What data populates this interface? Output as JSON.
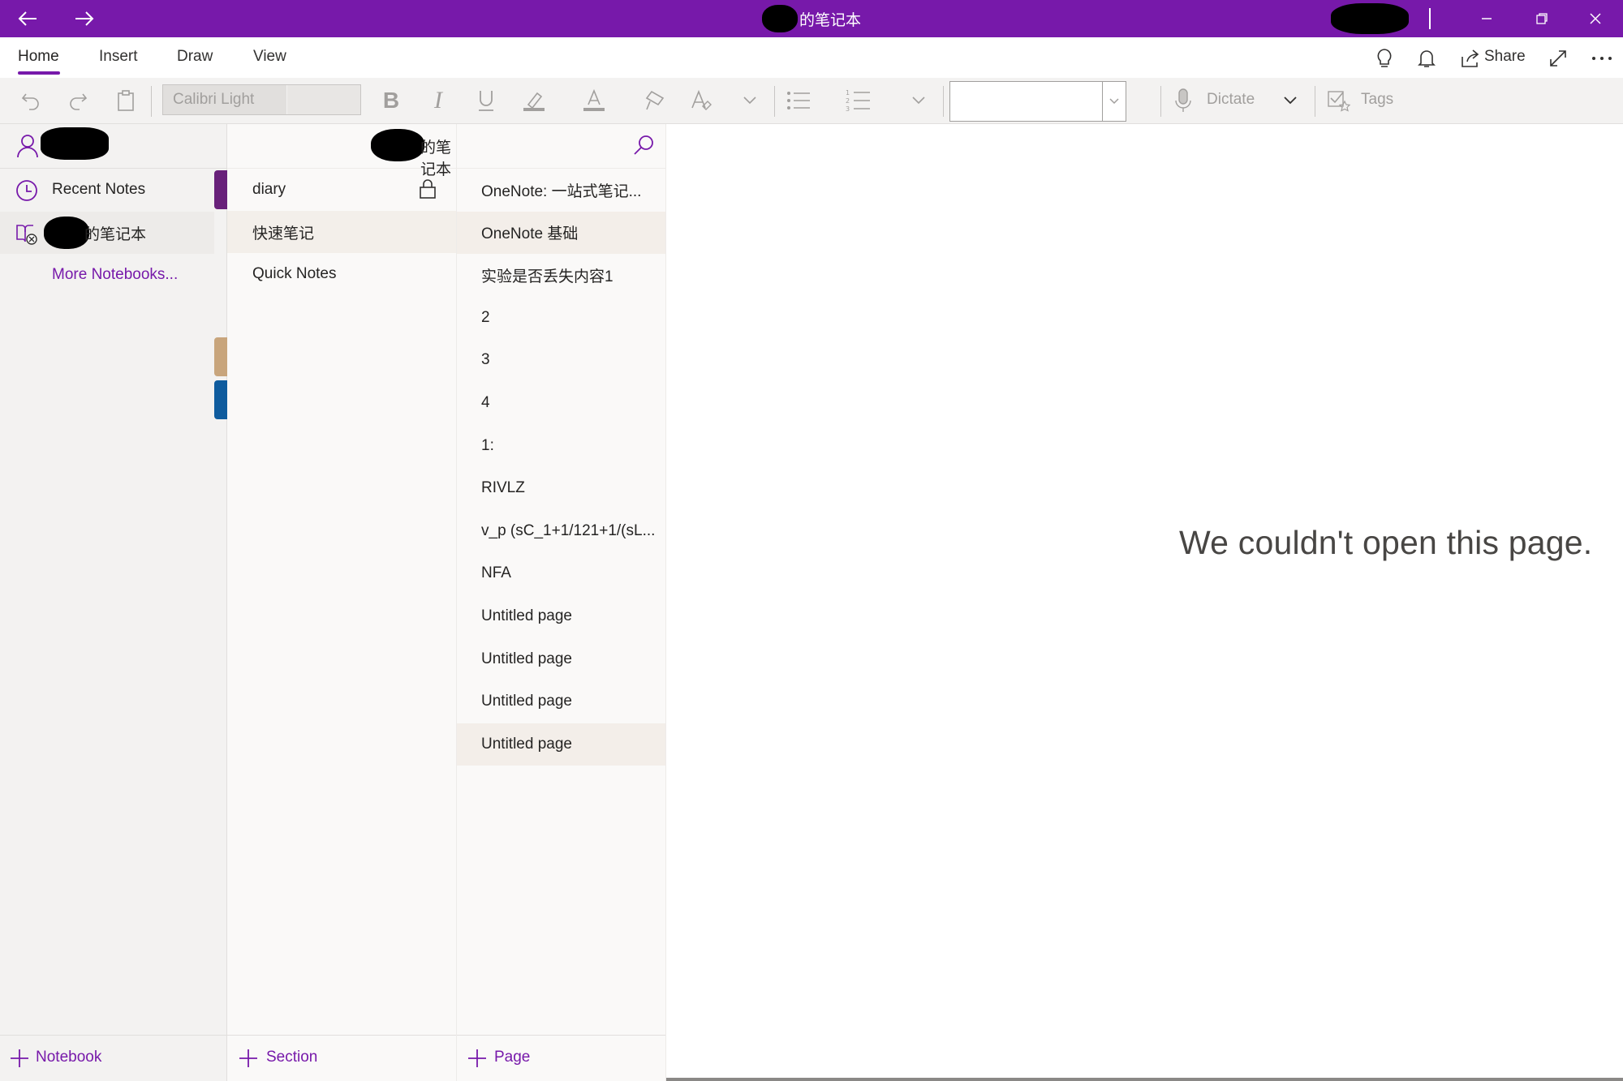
{
  "titlebar": {
    "title_suffix": "的笔记本",
    "colors": {
      "brand": "#7719aa"
    },
    "back_icon": "arrow-left-icon",
    "forward_icon": "arrow-right-icon"
  },
  "tabs": [
    {
      "label": "Home",
      "active": true
    },
    {
      "label": "Insert",
      "active": false
    },
    {
      "label": "Draw",
      "active": false
    },
    {
      "label": "View",
      "active": false
    }
  ],
  "tabs_right": {
    "share_label": "Share"
  },
  "ribbon": {
    "font_name": "Calibri Light",
    "dictate_label": "Dictate",
    "tags_label": "Tags"
  },
  "notebooks_pane": {
    "header_user_masked": true,
    "recent_notes_label": "Recent Notes",
    "notebook_name_suffix": "的笔记本",
    "more_notebooks_label": "More Notebooks...",
    "footer_label": "Notebook",
    "section_colors": [
      "#68217a",
      "#c8a57c",
      "#0f5c9e"
    ]
  },
  "sections_pane": {
    "header_suffix": "的笔记本",
    "sections": [
      {
        "label": "diary",
        "locked": true,
        "selected": false
      },
      {
        "label": "快速笔记",
        "locked": false,
        "selected": true
      },
      {
        "label": "Quick Notes",
        "locked": false,
        "selected": false
      }
    ],
    "footer_label": "Section"
  },
  "pages_pane": {
    "pages": [
      {
        "label": "OneNote: 一站式笔记...",
        "selected": false
      },
      {
        "label": "OneNote 基础",
        "selected": true
      },
      {
        "label": "实验是否丢失内容1",
        "selected": false
      },
      {
        "label": "2",
        "selected": false
      },
      {
        "label": "3",
        "selected": false
      },
      {
        "label": "4",
        "selected": false
      },
      {
        "label": "1:",
        "selected": false
      },
      {
        "label": "RIVLZ",
        "selected": false
      },
      {
        "label": "v_p (sC_1+1/121+1/(sL...",
        "selected": false
      },
      {
        "label": "NFA",
        "selected": false
      },
      {
        "label": "Untitled page",
        "selected": false
      },
      {
        "label": "Untitled page",
        "selected": false
      },
      {
        "label": "Untitled page",
        "selected": false
      },
      {
        "label": "Untitled page",
        "selected": true
      }
    ],
    "footer_label": "Page"
  },
  "content": {
    "message": "We couldn't open this page."
  }
}
